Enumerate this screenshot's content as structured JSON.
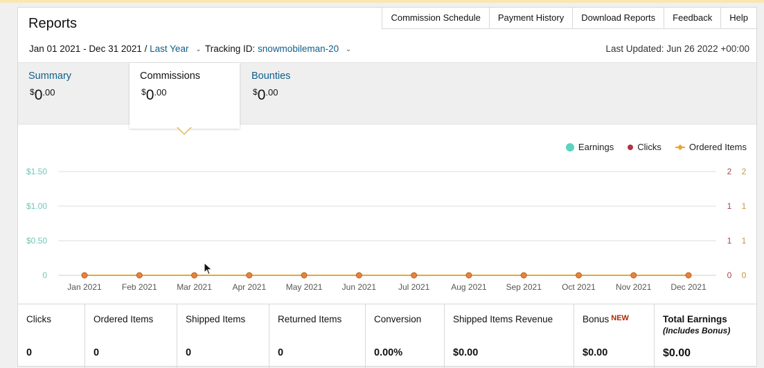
{
  "page": {
    "title": "Reports"
  },
  "nav": {
    "items": [
      {
        "label": "Commission Schedule"
      },
      {
        "label": "Payment History"
      },
      {
        "label": "Download Reports"
      },
      {
        "label": "Feedback"
      },
      {
        "label": "Help"
      }
    ]
  },
  "filters": {
    "date_range": "Jan 01 2021 - Dec 31 2021 /",
    "range_preset": "Last Year",
    "tracking_label": "Tracking ID:",
    "tracking_id": "snowmobileman-20",
    "last_updated": "Last Updated: Jun 26 2022 +00:00"
  },
  "tabs": [
    {
      "label": "Summary",
      "currency": "$",
      "whole": "0",
      "cents": ".00",
      "active": false
    },
    {
      "label": "Commissions",
      "currency": "$",
      "whole": "0",
      "cents": ".00",
      "active": true
    },
    {
      "label": "Bounties",
      "currency": "$",
      "whole": "0",
      "cents": ".00",
      "active": false
    }
  ],
  "legend": {
    "earnings": "Earnings",
    "clicks": "Clicks",
    "ordered": "Ordered Items"
  },
  "colors": {
    "earnings": "#5bd3c0",
    "clicks": "#b2333e",
    "ordered": "#e6a82e",
    "link": "#0f5e8a",
    "left_axis": "#6fc7b8",
    "right_axis1": "#a4454a",
    "right_axis2": "#c9953a"
  },
  "chart_data": {
    "type": "line",
    "categories": [
      "Jan 2021",
      "Feb 2021",
      "Mar 2021",
      "Apr 2021",
      "May 2021",
      "Jun 2021",
      "Jul 2021",
      "Aug 2021",
      "Sep 2021",
      "Oct 2021",
      "Nov 2021",
      "Dec 2021"
    ],
    "left_ticks": [
      "$1.50",
      "$1.00",
      "$0.50",
      "0"
    ],
    "right_ticks_clicks": [
      "2",
      "1",
      "1",
      "0"
    ],
    "right_ticks_ordered": [
      "2",
      "1",
      "1",
      "0"
    ],
    "series": [
      {
        "name": "Earnings",
        "values": [
          0,
          0,
          0,
          0,
          0,
          0,
          0,
          0,
          0,
          0,
          0,
          0
        ]
      },
      {
        "name": "Clicks",
        "values": [
          0,
          0,
          0,
          0,
          0,
          0,
          0,
          0,
          0,
          0,
          0,
          0
        ]
      },
      {
        "name": "Ordered Items",
        "values": [
          0,
          0,
          0,
          0,
          0,
          0,
          0,
          0,
          0,
          0,
          0,
          0
        ]
      }
    ],
    "ylim": [
      0,
      1.5
    ],
    "grid": true
  },
  "stats": [
    {
      "label": "Clicks",
      "value": "0"
    },
    {
      "label": "Ordered Items",
      "value": "0"
    },
    {
      "label": "Shipped Items",
      "value": "0"
    },
    {
      "label": "Returned Items",
      "value": "0"
    },
    {
      "label": "Conversion",
      "value": "0.00%"
    },
    {
      "label": "Shipped Items Revenue",
      "value": "$0.00"
    },
    {
      "label": "Bonus",
      "badge": "NEW",
      "value": "$0.00"
    },
    {
      "label": "Total Earnings",
      "sub": "(Includes Bonus)",
      "value": "$0.00"
    }
  ]
}
